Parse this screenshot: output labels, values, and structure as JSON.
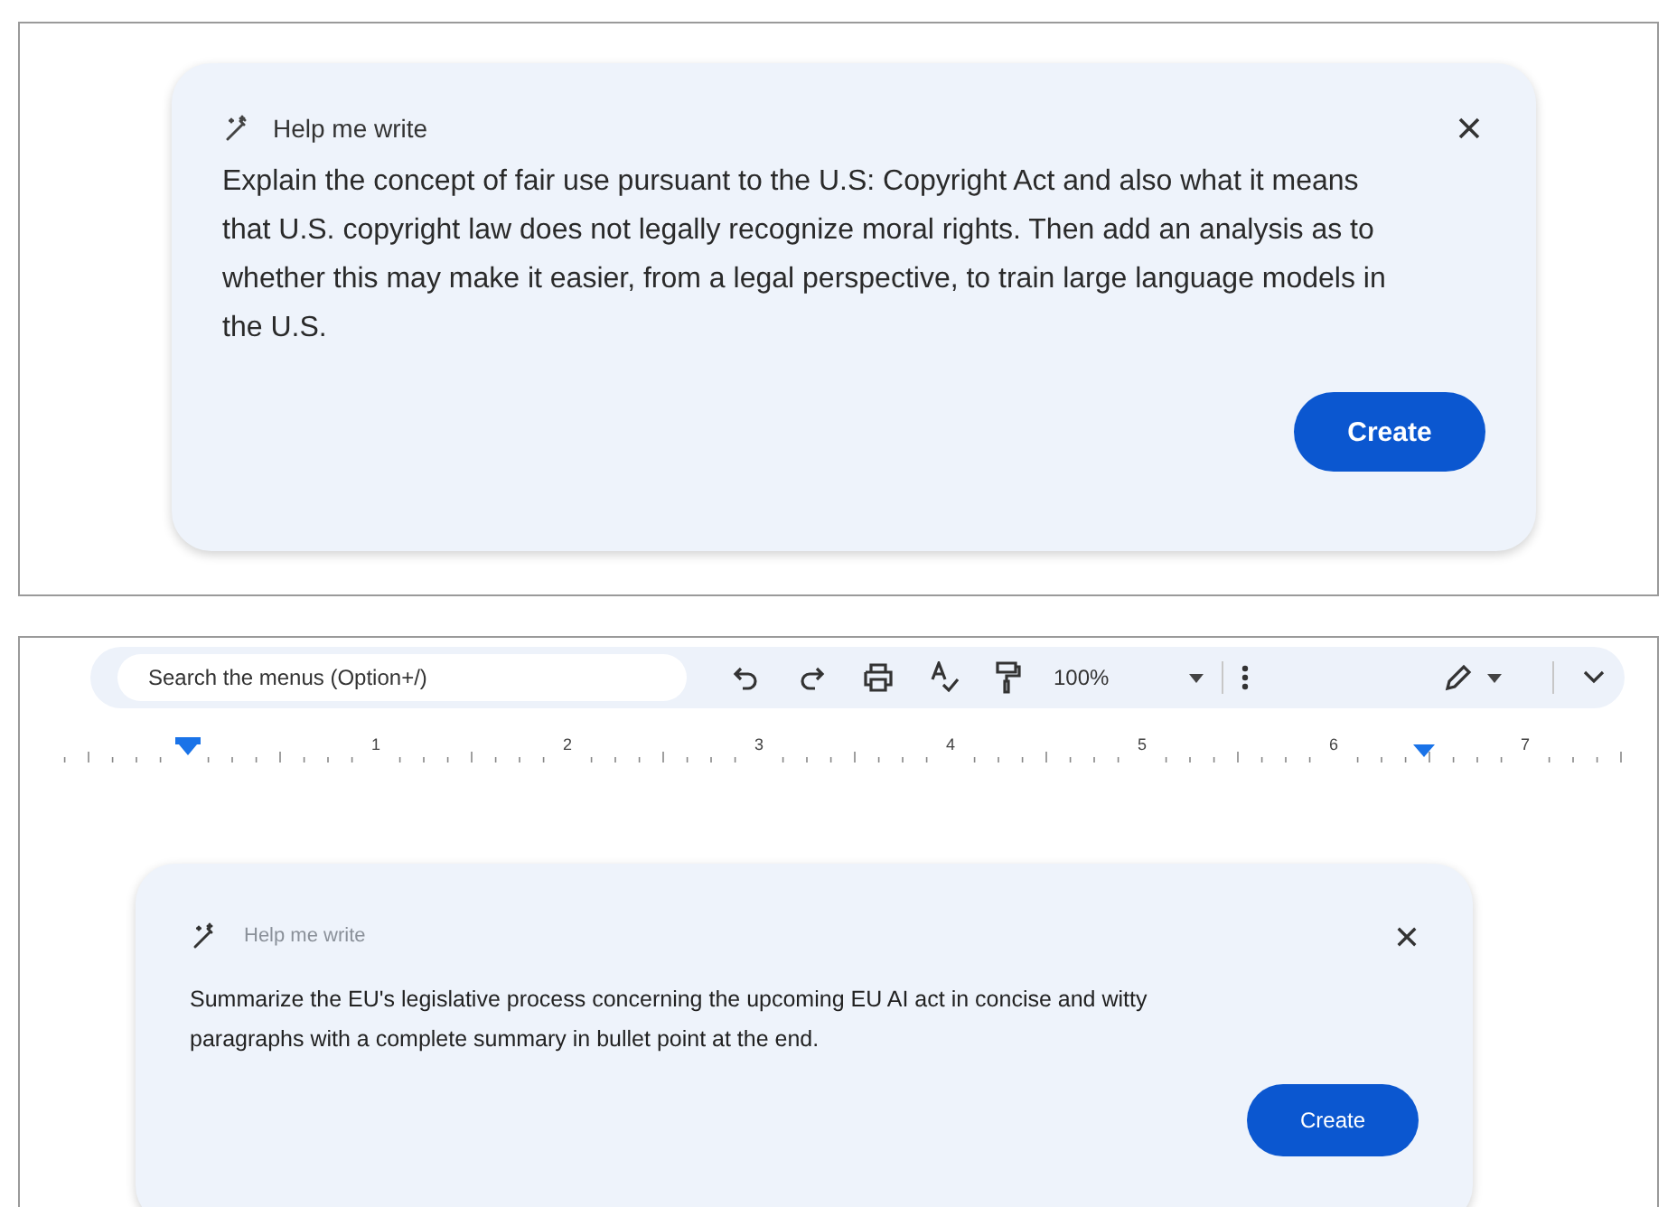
{
  "top_panel": {
    "dialog": {
      "title": "Help me write",
      "title_faded": false,
      "prompt": "Explain the concept of fair use pursuant to the U.S: Copyright Act and also what it means that U.S. copyright law does not legally recognize moral rights. Then add an analysis as to whether this may make it easier, from a legal perspective, to train large language models in the U.S.",
      "button": "Create"
    }
  },
  "bottom_panel": {
    "toolbar": {
      "search_placeholder": "Search the menus (Option+/)",
      "zoom": "100%"
    },
    "ruler": {
      "labels": [
        "1",
        "2",
        "3",
        "4",
        "5",
        "6",
        "7"
      ]
    },
    "dialog": {
      "title": "Help me write",
      "title_faded": true,
      "prompt": "Summarize the EU's legislative process concerning the upcoming EU AI act in concise and witty paragraphs with a complete summary in bullet point at the end.",
      "button": "Create"
    }
  }
}
